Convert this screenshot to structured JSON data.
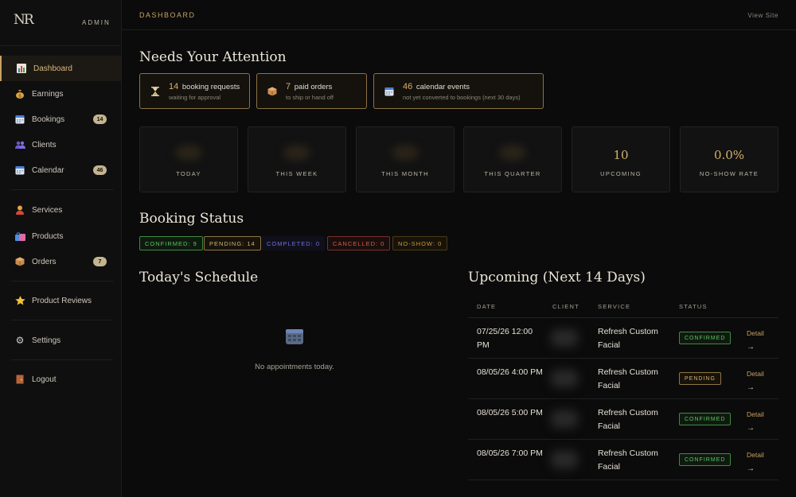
{
  "brand": {
    "logo_text": "NR",
    "logo_sub": "",
    "role": "ADMIN"
  },
  "sidebar": {
    "items": [
      {
        "label": "Dashboard",
        "icon": "chart-icon"
      },
      {
        "label": "Earnings",
        "icon": "money-bag-icon"
      },
      {
        "label": "Bookings",
        "icon": "calendar-icon",
        "badge": "14"
      },
      {
        "label": "Clients",
        "icon": "people-icon"
      },
      {
        "label": "Calendar",
        "icon": "calendar-icon",
        "badge": "46"
      },
      {
        "label": "Services",
        "icon": "person-icon"
      },
      {
        "label": "Products",
        "icon": "shopping-bags-icon"
      },
      {
        "label": "Orders",
        "icon": "package-icon",
        "badge": "7"
      },
      {
        "label": "Product Reviews",
        "icon": "star-icon"
      },
      {
        "label": "Settings",
        "icon": "gear-icon"
      },
      {
        "label": "Logout",
        "icon": "door-icon"
      }
    ]
  },
  "topbar": {
    "breadcrumb": "DASHBOARD",
    "view_site": "View Site"
  },
  "attention": {
    "title": "Needs Your Attention",
    "cards": [
      {
        "count": "14",
        "label": "booking requests",
        "sub": "waiting for approval",
        "icon": "hourglass-icon"
      },
      {
        "count": "7",
        "label": "paid orders",
        "sub": "to ship or hand off",
        "icon": "package-icon"
      },
      {
        "count": "46",
        "label": "calendar events",
        "sub": "not yet converted to bookings (next 30 days)",
        "icon": "calendar-icon"
      }
    ]
  },
  "stats": [
    {
      "label": "TODAY",
      "value": ""
    },
    {
      "label": "THIS WEEK",
      "value": ""
    },
    {
      "label": "THIS MONTH",
      "value": ""
    },
    {
      "label": "THIS QUARTER",
      "value": ""
    },
    {
      "label": "UPCOMING",
      "value": "10"
    },
    {
      "label": "NO-SHOW RATE",
      "value": "0.0%"
    }
  ],
  "booking_status": {
    "title": "Booking Status",
    "chips": [
      "CONFIRMED: 9",
      "PENDING: 14",
      "COMPLETED: 0",
      "CANCELLED: 0",
      "NO-SHOW: 0"
    ],
    "colors": {
      "confirmed": "#5dc262",
      "pending": "#d4b272",
      "completed": "#6f6fd6",
      "cancelled": "#d85a4f",
      "noshow": "#c99a3a"
    }
  },
  "today": {
    "title": "Today's Schedule",
    "empty": "No appointments today."
  },
  "upcoming": {
    "title": "Upcoming (Next 14 Days)",
    "headers": [
      "DATE",
      "CLIENT",
      "SERVICE",
      "STATUS"
    ],
    "rows": [
      {
        "date": "07/25/26 12:00 PM",
        "service": "Refresh Custom Facial",
        "status": "CONFIRMED",
        "action": "Detail",
        "arrow": "→"
      },
      {
        "date": "08/05/26 4:00 PM",
        "service": "Refresh Custom Facial",
        "status": "PENDING",
        "action": "Detail",
        "arrow": "→"
      },
      {
        "date": "08/05/26 5:00 PM",
        "service": "Refresh Custom Facial",
        "status": "CONFIRMED",
        "action": "Detail",
        "arrow": "→"
      },
      {
        "date": "08/05/26 7:00 PM",
        "service": "Refresh Custom Facial",
        "status": "CONFIRMED",
        "action": "Detail",
        "arrow": "→"
      }
    ]
  }
}
